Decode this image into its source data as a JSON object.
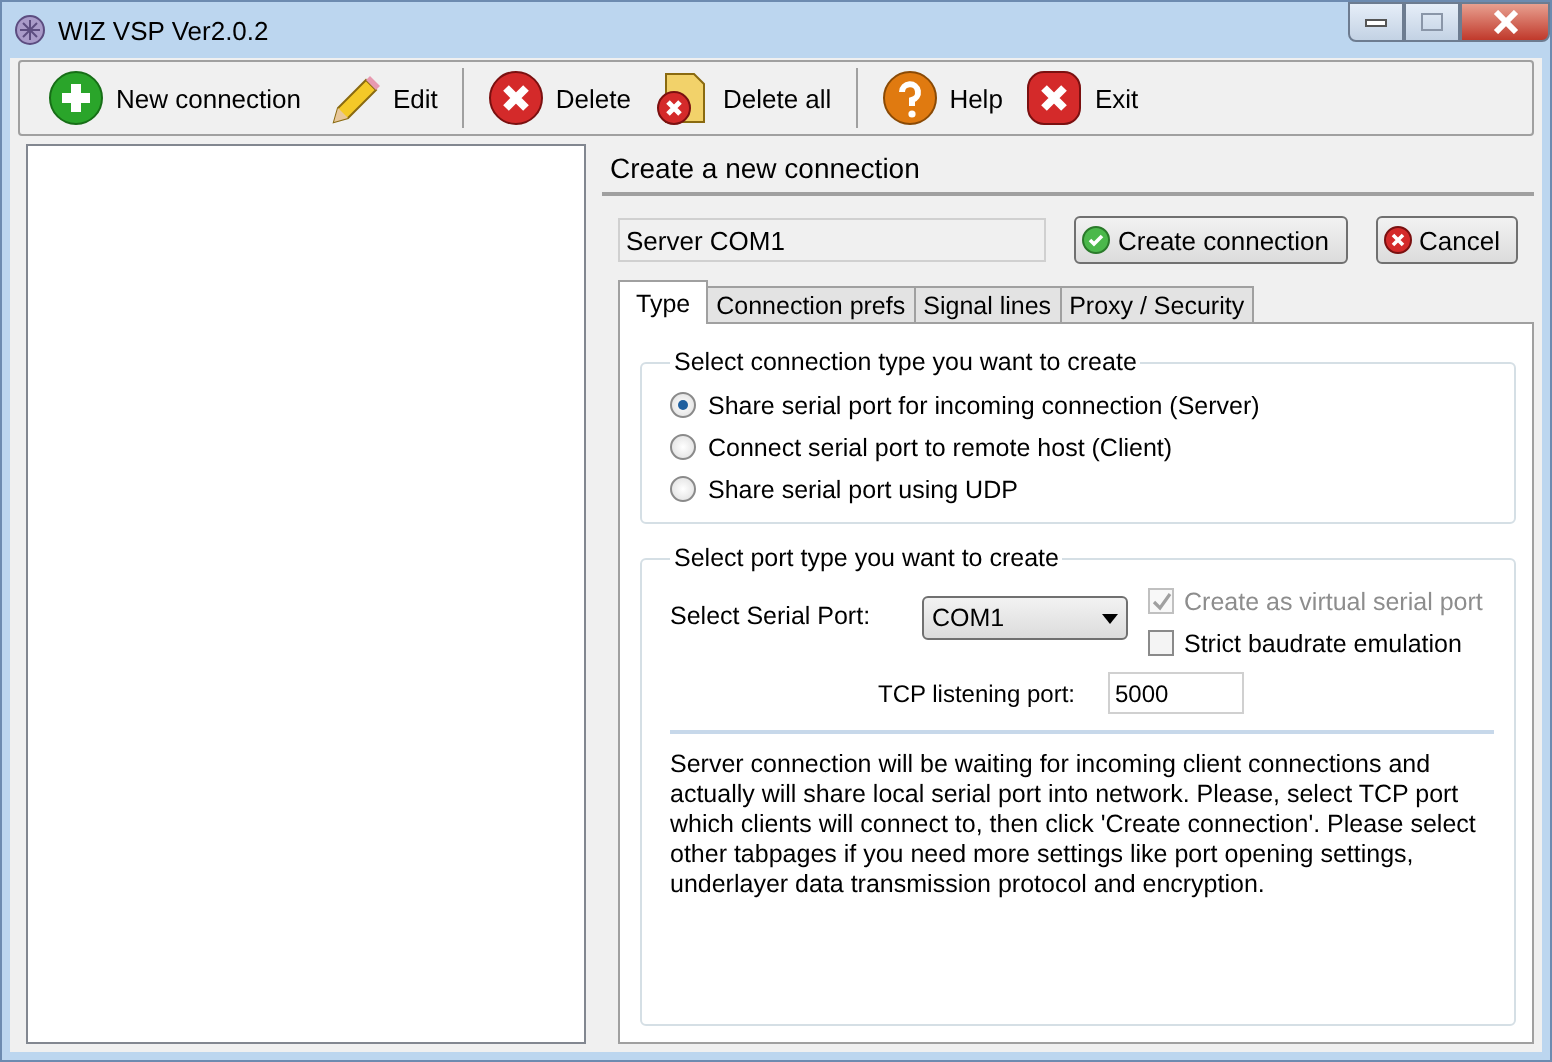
{
  "window": {
    "title": "WIZ VSP Ver2.0.2"
  },
  "toolbar": [
    {
      "kind": "add",
      "label": "New connection"
    },
    {
      "kind": "edit",
      "label": "Edit"
    },
    {
      "kind": "delete",
      "label": "Delete"
    },
    {
      "kind": "delete_all",
      "label": "Delete all"
    },
    {
      "kind": "help",
      "label": "Help"
    },
    {
      "kind": "exit",
      "label": "Exit"
    }
  ],
  "panel": {
    "title": "Create a new connection",
    "name_value": "Server COM1",
    "create_button": "Create connection",
    "cancel_button": "Cancel",
    "tabs": [
      {
        "label": "Type",
        "selected": true
      },
      {
        "label": "Connection prefs",
        "selected": false
      },
      {
        "label": "Signal lines",
        "selected": false
      },
      {
        "label": "Proxy / Security",
        "selected": false
      }
    ],
    "connection_group": {
      "title": "Select connection type you want to create",
      "options": [
        {
          "label": "Share serial port for incoming connection (Server)",
          "selected": true
        },
        {
          "label": "Connect serial port to remote host (Client)",
          "selected": false
        },
        {
          "label": "Share serial port using UDP",
          "selected": false
        }
      ]
    },
    "port_group": {
      "title": "Select port type you want to create",
      "serial_port_label": "Select Serial Port:",
      "serial_port_value": "COM1",
      "checkboxes": [
        {
          "label": "Create as virtual serial port",
          "checked": true,
          "disabled": true
        },
        {
          "label": "Strict baudrate emulation",
          "checked": false,
          "disabled": false
        }
      ],
      "tcp_label": "TCP listening port:",
      "tcp_value": "5000",
      "description": "Server connection will be waiting for incoming client connections and actually will share local serial port into network. Please, select TCP port which clients will connect to, then click 'Create connection'. Please select other tabpages if you need more settings like port opening settings, underlayer data transmission protocol and encryption."
    }
  }
}
